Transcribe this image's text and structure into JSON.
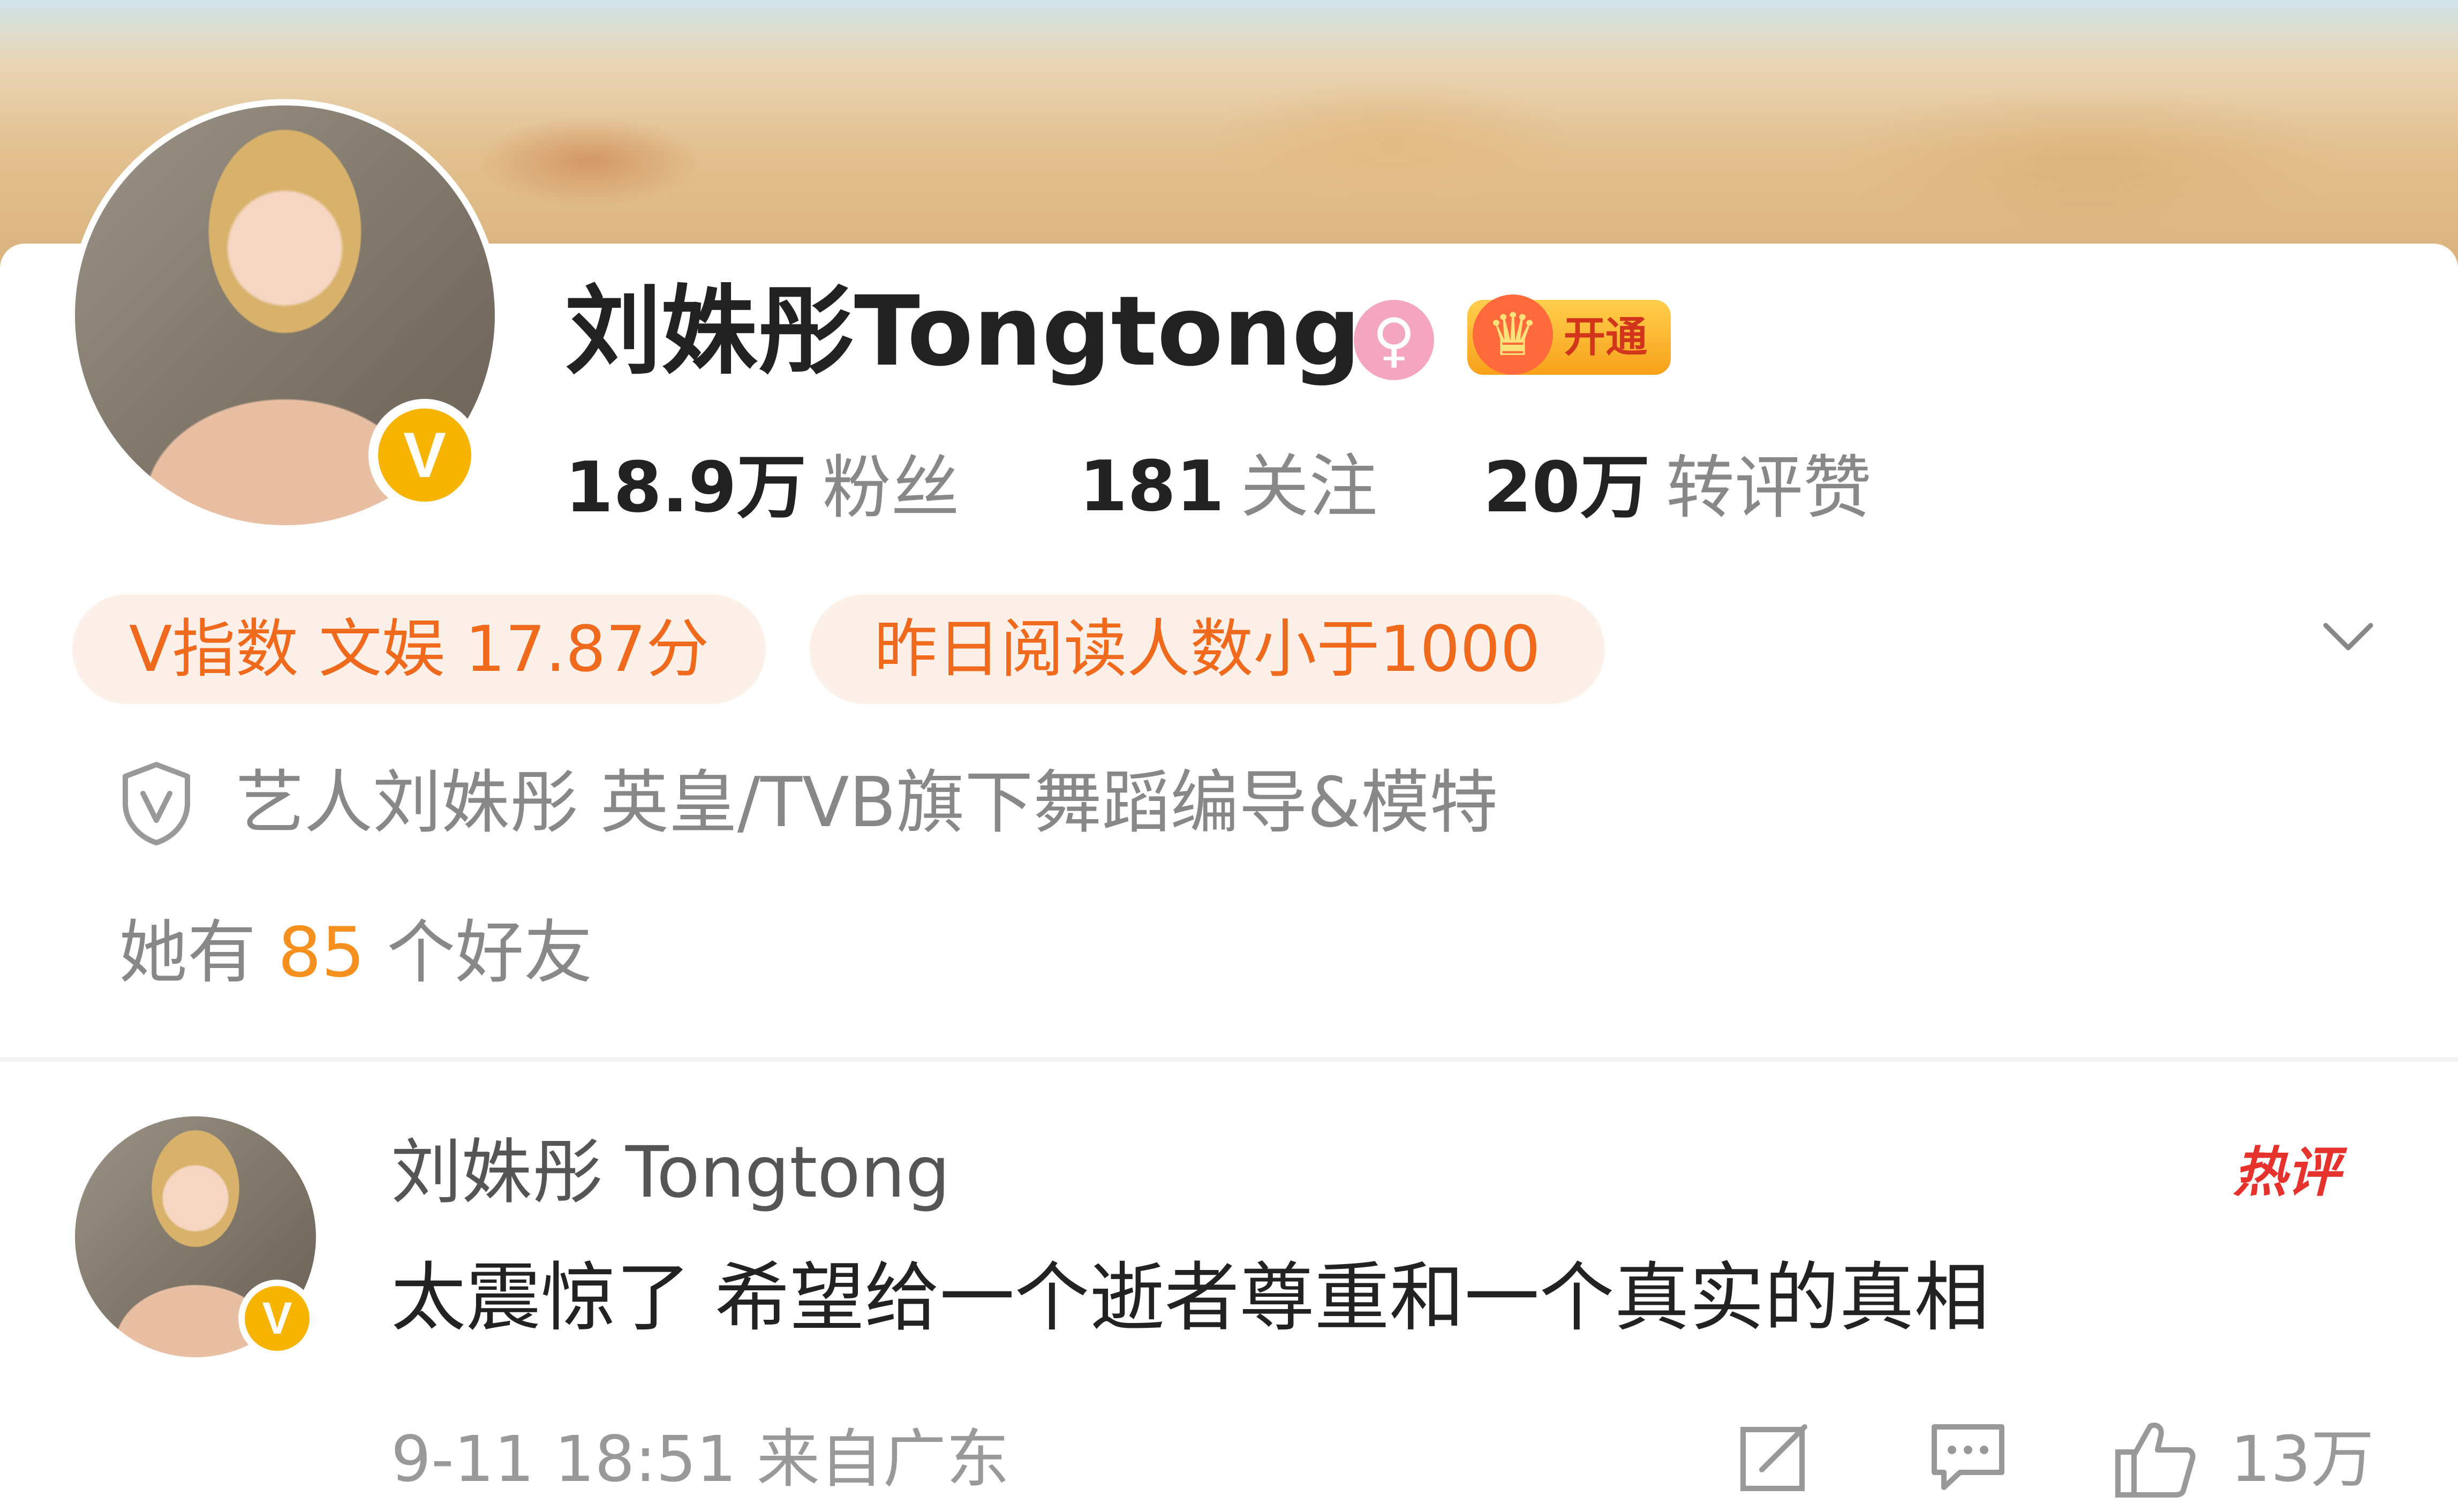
{
  "profile": {
    "name": "刘姝彤Tongtong",
    "gender_icon": "female-icon",
    "vip_label": "开通",
    "stats": [
      {
        "value": "18.9万",
        "label": "粉丝"
      },
      {
        "value": "181",
        "label": "关注"
      },
      {
        "value": "20万",
        "label": "转评赞"
      }
    ],
    "chips": {
      "v_index": "V指数 文娱 17.87分",
      "reads": "昨日阅读人数小于1000"
    },
    "description": "艺人刘姝彤 英皇/TVB旗下舞蹈编导&模特",
    "friends": {
      "prefix": "她有",
      "count": "85",
      "suffix": "个好友"
    },
    "verified_badge": "V"
  },
  "comment": {
    "author": "刘姝彤 Tongtong",
    "badge": "热评",
    "text": "太震惊了 希望给一个逝者尊重和一个真实的真相",
    "time_source": "9-11 18:51 来自广东",
    "like_count": "13万",
    "verified_badge": "V"
  },
  "colors": {
    "accent_orange": "#f06a1e",
    "chip_bg": "#fdf0e8",
    "verified_gold": "#f6b400",
    "hot_red": "#e5322d"
  }
}
